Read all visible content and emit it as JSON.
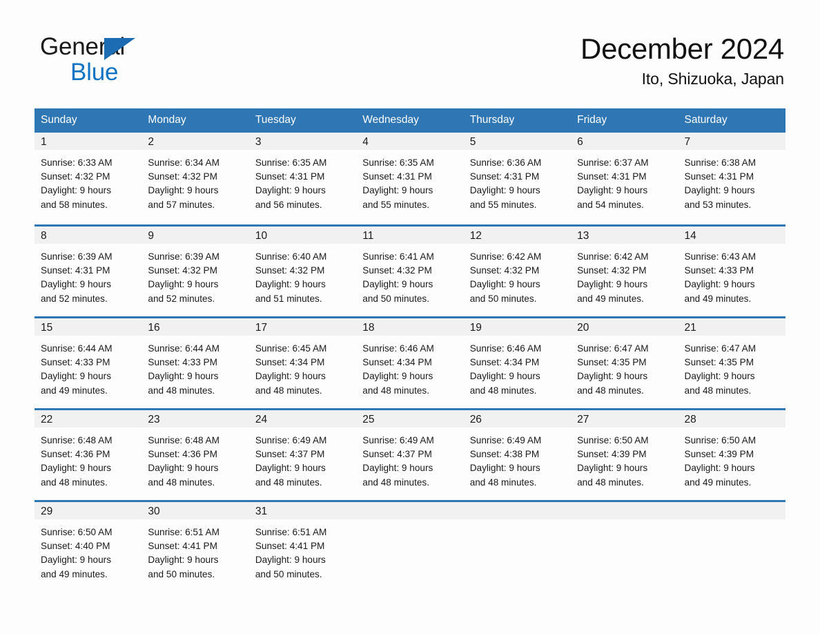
{
  "brand": {
    "name_line1": "General",
    "name_line2": "Blue",
    "flag_icon": "triangle-flag-icon",
    "color_dark": "#1a1a1a",
    "color_blue": "#1173c4"
  },
  "header": {
    "month_title": "December 2024",
    "location": "Ito, Shizuoka, Japan"
  },
  "theme": {
    "header_bg": "#2f76b5",
    "header_text": "#ffffff",
    "row_divider": "#2f76b5",
    "daynum_band_bg": "#f1f1f1",
    "page_bg": "#fdfdfd",
    "body_text": "#1a1a1a"
  },
  "weekday_headers": [
    "Sunday",
    "Monday",
    "Tuesday",
    "Wednesday",
    "Thursday",
    "Friday",
    "Saturday"
  ],
  "weeks": [
    [
      {
        "day": "1",
        "sunrise": "Sunrise: 6:33 AM",
        "sunset": "Sunset: 4:32 PM",
        "daylight_line1": "Daylight: 9 hours",
        "daylight_line2": "and 58 minutes."
      },
      {
        "day": "2",
        "sunrise": "Sunrise: 6:34 AM",
        "sunset": "Sunset: 4:32 PM",
        "daylight_line1": "Daylight: 9 hours",
        "daylight_line2": "and 57 minutes."
      },
      {
        "day": "3",
        "sunrise": "Sunrise: 6:35 AM",
        "sunset": "Sunset: 4:31 PM",
        "daylight_line1": "Daylight: 9 hours",
        "daylight_line2": "and 56 minutes."
      },
      {
        "day": "4",
        "sunrise": "Sunrise: 6:35 AM",
        "sunset": "Sunset: 4:31 PM",
        "daylight_line1": "Daylight: 9 hours",
        "daylight_line2": "and 55 minutes."
      },
      {
        "day": "5",
        "sunrise": "Sunrise: 6:36 AM",
        "sunset": "Sunset: 4:31 PM",
        "daylight_line1": "Daylight: 9 hours",
        "daylight_line2": "and 55 minutes."
      },
      {
        "day": "6",
        "sunrise": "Sunrise: 6:37 AM",
        "sunset": "Sunset: 4:31 PM",
        "daylight_line1": "Daylight: 9 hours",
        "daylight_line2": "and 54 minutes."
      },
      {
        "day": "7",
        "sunrise": "Sunrise: 6:38 AM",
        "sunset": "Sunset: 4:31 PM",
        "daylight_line1": "Daylight: 9 hours",
        "daylight_line2": "and 53 minutes."
      }
    ],
    [
      {
        "day": "8",
        "sunrise": "Sunrise: 6:39 AM",
        "sunset": "Sunset: 4:31 PM",
        "daylight_line1": "Daylight: 9 hours",
        "daylight_line2": "and 52 minutes."
      },
      {
        "day": "9",
        "sunrise": "Sunrise: 6:39 AM",
        "sunset": "Sunset: 4:32 PM",
        "daylight_line1": "Daylight: 9 hours",
        "daylight_line2": "and 52 minutes."
      },
      {
        "day": "10",
        "sunrise": "Sunrise: 6:40 AM",
        "sunset": "Sunset: 4:32 PM",
        "daylight_line1": "Daylight: 9 hours",
        "daylight_line2": "and 51 minutes."
      },
      {
        "day": "11",
        "sunrise": "Sunrise: 6:41 AM",
        "sunset": "Sunset: 4:32 PM",
        "daylight_line1": "Daylight: 9 hours",
        "daylight_line2": "and 50 minutes."
      },
      {
        "day": "12",
        "sunrise": "Sunrise: 6:42 AM",
        "sunset": "Sunset: 4:32 PM",
        "daylight_line1": "Daylight: 9 hours",
        "daylight_line2": "and 50 minutes."
      },
      {
        "day": "13",
        "sunrise": "Sunrise: 6:42 AM",
        "sunset": "Sunset: 4:32 PM",
        "daylight_line1": "Daylight: 9 hours",
        "daylight_line2": "and 49 minutes."
      },
      {
        "day": "14",
        "sunrise": "Sunrise: 6:43 AM",
        "sunset": "Sunset: 4:33 PM",
        "daylight_line1": "Daylight: 9 hours",
        "daylight_line2": "and 49 minutes."
      }
    ],
    [
      {
        "day": "15",
        "sunrise": "Sunrise: 6:44 AM",
        "sunset": "Sunset: 4:33 PM",
        "daylight_line1": "Daylight: 9 hours",
        "daylight_line2": "and 49 minutes."
      },
      {
        "day": "16",
        "sunrise": "Sunrise: 6:44 AM",
        "sunset": "Sunset: 4:33 PM",
        "daylight_line1": "Daylight: 9 hours",
        "daylight_line2": "and 48 minutes."
      },
      {
        "day": "17",
        "sunrise": "Sunrise: 6:45 AM",
        "sunset": "Sunset: 4:34 PM",
        "daylight_line1": "Daylight: 9 hours",
        "daylight_line2": "and 48 minutes."
      },
      {
        "day": "18",
        "sunrise": "Sunrise: 6:46 AM",
        "sunset": "Sunset: 4:34 PM",
        "daylight_line1": "Daylight: 9 hours",
        "daylight_line2": "and 48 minutes."
      },
      {
        "day": "19",
        "sunrise": "Sunrise: 6:46 AM",
        "sunset": "Sunset: 4:34 PM",
        "daylight_line1": "Daylight: 9 hours",
        "daylight_line2": "and 48 minutes."
      },
      {
        "day": "20",
        "sunrise": "Sunrise: 6:47 AM",
        "sunset": "Sunset: 4:35 PM",
        "daylight_line1": "Daylight: 9 hours",
        "daylight_line2": "and 48 minutes."
      },
      {
        "day": "21",
        "sunrise": "Sunrise: 6:47 AM",
        "sunset": "Sunset: 4:35 PM",
        "daylight_line1": "Daylight: 9 hours",
        "daylight_line2": "and 48 minutes."
      }
    ],
    [
      {
        "day": "22",
        "sunrise": "Sunrise: 6:48 AM",
        "sunset": "Sunset: 4:36 PM",
        "daylight_line1": "Daylight: 9 hours",
        "daylight_line2": "and 48 minutes."
      },
      {
        "day": "23",
        "sunrise": "Sunrise: 6:48 AM",
        "sunset": "Sunset: 4:36 PM",
        "daylight_line1": "Daylight: 9 hours",
        "daylight_line2": "and 48 minutes."
      },
      {
        "day": "24",
        "sunrise": "Sunrise: 6:49 AM",
        "sunset": "Sunset: 4:37 PM",
        "daylight_line1": "Daylight: 9 hours",
        "daylight_line2": "and 48 minutes."
      },
      {
        "day": "25",
        "sunrise": "Sunrise: 6:49 AM",
        "sunset": "Sunset: 4:37 PM",
        "daylight_line1": "Daylight: 9 hours",
        "daylight_line2": "and 48 minutes."
      },
      {
        "day": "26",
        "sunrise": "Sunrise: 6:49 AM",
        "sunset": "Sunset: 4:38 PM",
        "daylight_line1": "Daylight: 9 hours",
        "daylight_line2": "and 48 minutes."
      },
      {
        "day": "27",
        "sunrise": "Sunrise: 6:50 AM",
        "sunset": "Sunset: 4:39 PM",
        "daylight_line1": "Daylight: 9 hours",
        "daylight_line2": "and 48 minutes."
      },
      {
        "day": "28",
        "sunrise": "Sunrise: 6:50 AM",
        "sunset": "Sunset: 4:39 PM",
        "daylight_line1": "Daylight: 9 hours",
        "daylight_line2": "and 49 minutes."
      }
    ],
    [
      {
        "day": "29",
        "sunrise": "Sunrise: 6:50 AM",
        "sunset": "Sunset: 4:40 PM",
        "daylight_line1": "Daylight: 9 hours",
        "daylight_line2": "and 49 minutes."
      },
      {
        "day": "30",
        "sunrise": "Sunrise: 6:51 AM",
        "sunset": "Sunset: 4:41 PM",
        "daylight_line1": "Daylight: 9 hours",
        "daylight_line2": "and 50 minutes."
      },
      {
        "day": "31",
        "sunrise": "Sunrise: 6:51 AM",
        "sunset": "Sunset: 4:41 PM",
        "daylight_line1": "Daylight: 9 hours",
        "daylight_line2": "and 50 minutes."
      },
      {
        "day": "",
        "sunrise": "",
        "sunset": "",
        "daylight_line1": "",
        "daylight_line2": ""
      },
      {
        "day": "",
        "sunrise": "",
        "sunset": "",
        "daylight_line1": "",
        "daylight_line2": ""
      },
      {
        "day": "",
        "sunrise": "",
        "sunset": "",
        "daylight_line1": "",
        "daylight_line2": ""
      },
      {
        "day": "",
        "sunrise": "",
        "sunset": "",
        "daylight_line1": "",
        "daylight_line2": ""
      }
    ]
  ]
}
